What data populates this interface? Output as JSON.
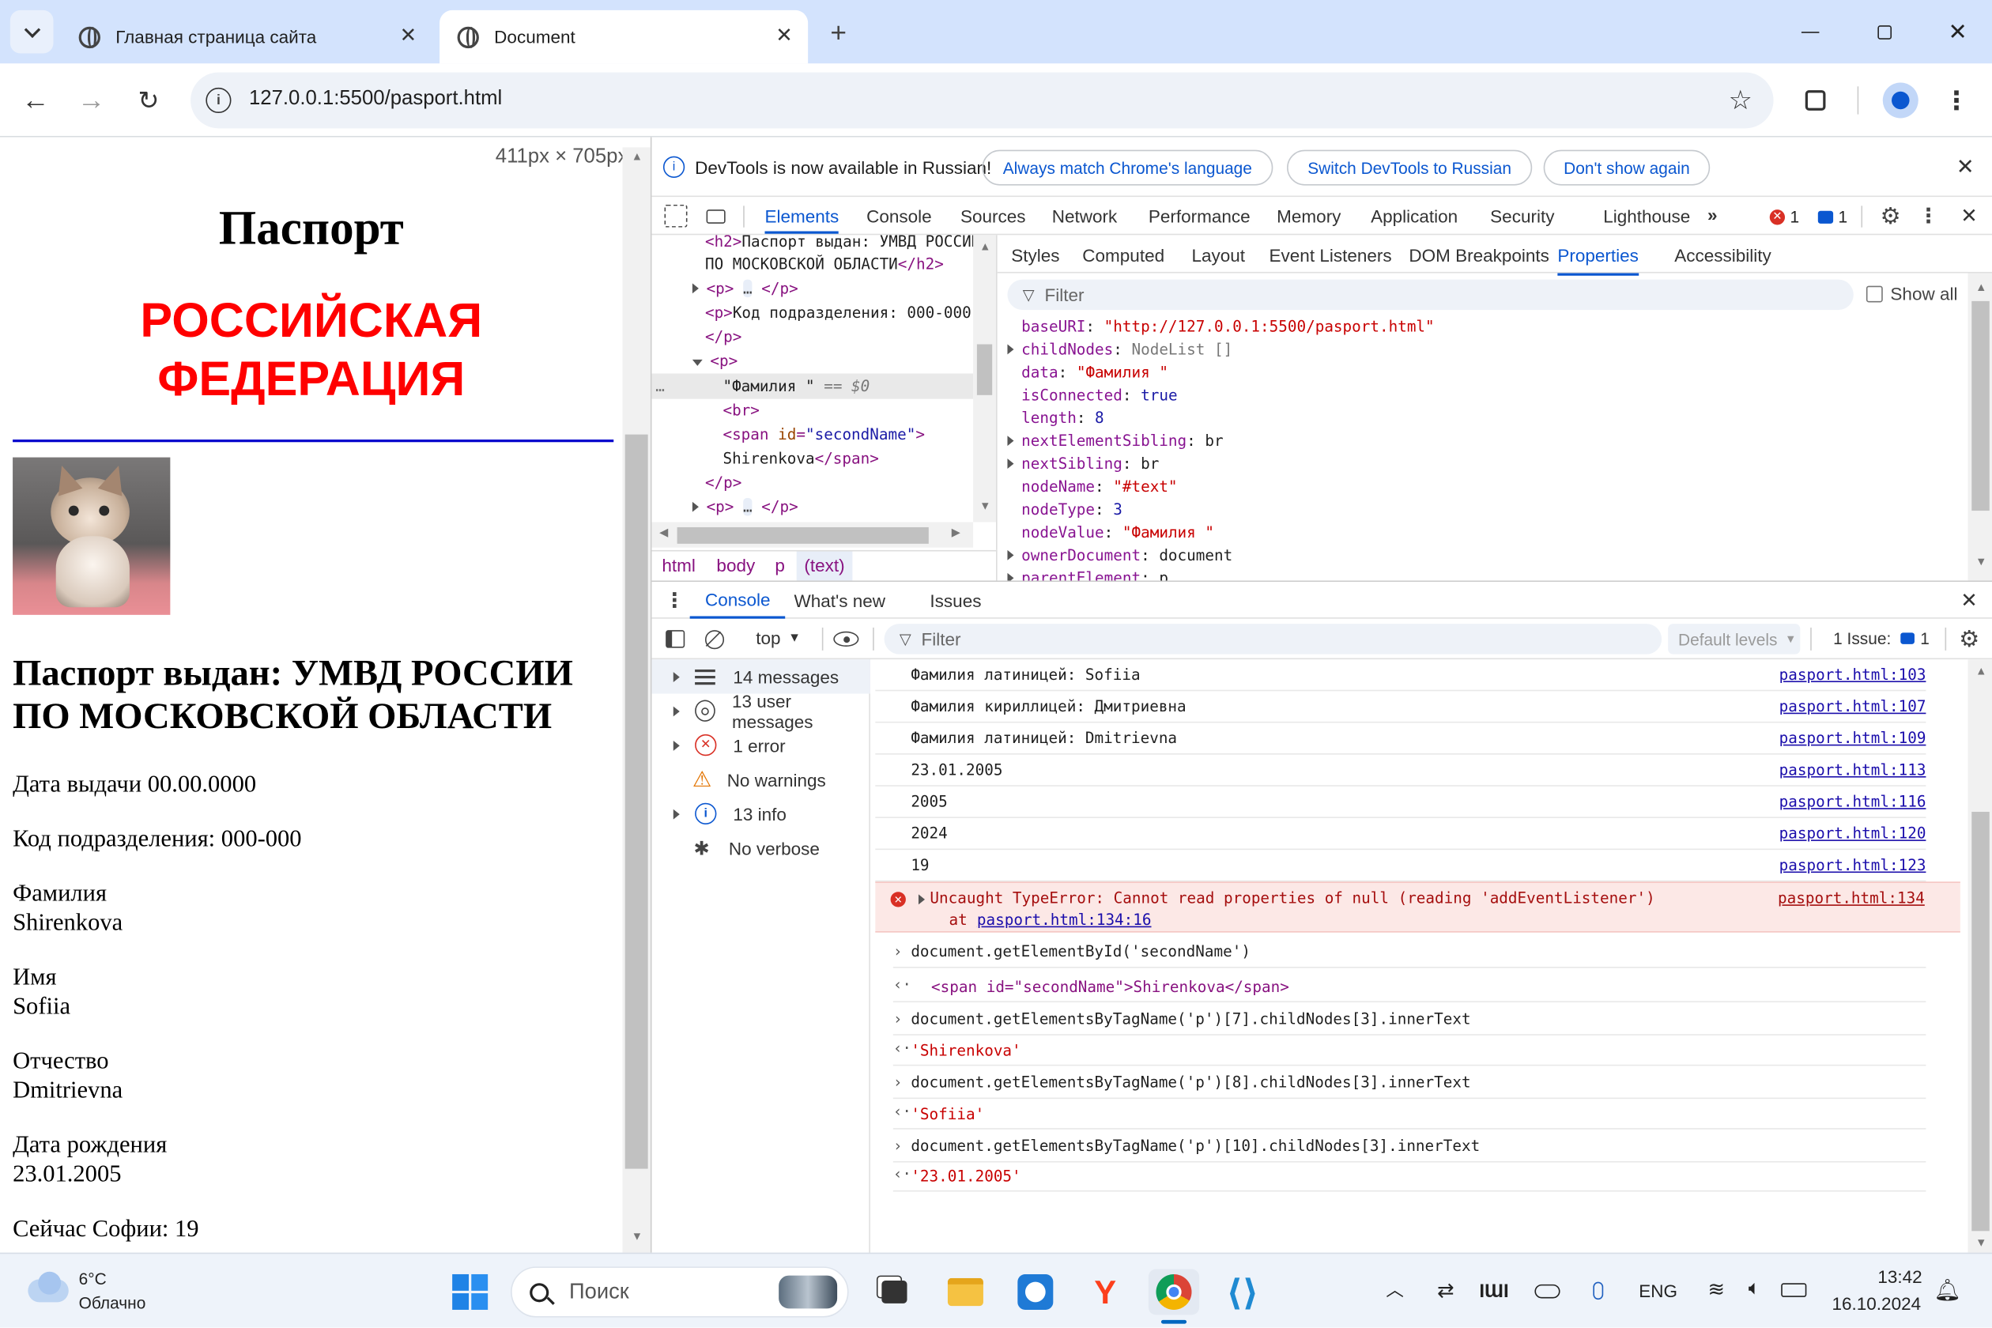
{
  "browser": {
    "tabs": [
      {
        "title": "Главная страница сайта"
      },
      {
        "title": "Document"
      }
    ],
    "url": "127.0.0.1:5500/pasport.html",
    "viewport_size": "411px × 705px"
  },
  "page": {
    "title": "Паспорт",
    "country_line1": "РОССИЙСКАЯ",
    "country_line2": "ФЕДЕРАЦИЯ",
    "issued_line1": "Паспорт выдан: УМВД РОССИИ",
    "issued_line2": "ПО МОСКОВСКОЙ ОБЛАСТИ",
    "issue_date": "Дата выдачи 00.00.0000",
    "division_code": "Код подразделения: 000-000",
    "surname_label": "Фамилия",
    "surname": "Shirenkova",
    "name_label": "Имя",
    "name": "Sofiia",
    "patronymic_label": "Отчество",
    "patronymic": "Dmitrievna",
    "birth_label": "Дата рождения",
    "birth": "23.01.2005",
    "age_line": "Сейчас Софии: 19"
  },
  "devtools": {
    "infobar": {
      "text": "DevTools is now available in Russian!",
      "btn1": "Always match Chrome's language",
      "btn2": "Switch DevTools to Russian",
      "btn3": "Don't show again"
    },
    "main_tabs": [
      "Elements",
      "Console",
      "Sources",
      "Network",
      "Performance",
      "Memory",
      "Application",
      "Security",
      "Lighthouse"
    ],
    "errors_count": "1",
    "issues_count": "1",
    "elements": {
      "l1": "ПО МОСКОВСКОЙ ОБЛАСТИ",
      "l2_text": "Код подразделения: 000-000",
      "l5_text": "\"Фамилия \"",
      "l5_eq": "== $0",
      "l7_attr_val": "\"secondName\"",
      "l8_text": "Shirenkova",
      "l0_text": "Паспорт выдан: УМВД РОССИИ"
    },
    "breadcrumbs": [
      "html",
      "body",
      "p",
      "(text)"
    ],
    "side_tabs": [
      "Styles",
      "Computed",
      "Layout",
      "Event Listeners",
      "DOM Breakpoints",
      "Properties",
      "Accessibility"
    ],
    "filter_placeholder": "Filter",
    "show_all": "Show all",
    "properties": [
      {
        "k": "baseURI",
        "v": "\"http://127.0.0.1:5500/pasport.html\"",
        "t": "str",
        "exp": false
      },
      {
        "k": "childNodes",
        "v": "NodeList []",
        "t": "obj",
        "exp": true
      },
      {
        "k": "data",
        "v": "\"Фамилия \"",
        "t": "str",
        "exp": false
      },
      {
        "k": "isConnected",
        "v": "true",
        "t": "num",
        "exp": false
      },
      {
        "k": "length",
        "v": "8",
        "t": "num",
        "exp": false
      },
      {
        "k": "nextElementSibling",
        "v": "br",
        "t": "plain",
        "exp": true
      },
      {
        "k": "nextSibling",
        "v": "br",
        "t": "plain",
        "exp": true
      },
      {
        "k": "nodeName",
        "v": "\"#text\"",
        "t": "str",
        "exp": false
      },
      {
        "k": "nodeType",
        "v": "3",
        "t": "num",
        "exp": false
      },
      {
        "k": "nodeValue",
        "v": "\"Фамилия \"",
        "t": "str",
        "exp": false
      },
      {
        "k": "ownerDocument",
        "v": "document",
        "t": "plain",
        "exp": true
      },
      {
        "k": "parentElement",
        "v": "p",
        "t": "plain",
        "exp": true
      }
    ],
    "drawer_tabs": [
      "Console",
      "What's new",
      "Issues"
    ],
    "console_toolbar": {
      "context": "top",
      "filter": "Filter",
      "levels": "Default levels",
      "issues": "1 Issue:",
      "issue_count": "1"
    },
    "sidebar": [
      {
        "label": "14 messages",
        "icon": "list-icon"
      },
      {
        "label": "13 user messages",
        "icon": "user-icon"
      },
      {
        "label": "1 error",
        "icon": "error-icon"
      },
      {
        "label": "No warnings",
        "icon": "warning-icon"
      },
      {
        "label": "13 info",
        "icon": "info-icon"
      },
      {
        "label": "No verbose",
        "icon": "bug-icon"
      }
    ],
    "logs": [
      {
        "text": "Фамилия латиницей: Sofiia",
        "src": "pasport.html:103"
      },
      {
        "text": "Фамилия кириллицей: Дмитриевна",
        "src": "pasport.html:107"
      },
      {
        "text": "Фамилия латиницей: Dmitrievna",
        "src": "pasport.html:109"
      },
      {
        "text": "23.01.2005",
        "src": "pasport.html:113"
      },
      {
        "text": "2005",
        "src": "pasport.html:116"
      },
      {
        "text": "2024",
        "src": "pasport.html:120"
      },
      {
        "text": "19",
        "src": "pasport.html:123"
      }
    ],
    "error": {
      "msg": "Uncaught TypeError: Cannot read properties of null (reading 'addEventListener')",
      "at": "at",
      "at_link": "pasport.html:134:16",
      "src": "pasport.html:134"
    },
    "cmds": [
      {
        "in": "document.getElementById('secondName')",
        "out": "<span id=\"secondName\">Shirenkova</span>"
      },
      {
        "in": "document.getElementsByTagName('p')[7].childNodes[3].innerText",
        "out": "'Shirenkova'"
      },
      {
        "in": "document.getElementsByTagName('p')[8].childNodes[3].innerText",
        "out": "'Sofiia'"
      },
      {
        "in": "document.getElementsByTagName('p')[10].childNodes[3].innerText",
        "out": "'23.01.2005'"
      }
    ]
  },
  "taskbar": {
    "temp": "6°C",
    "weather": "Облачно",
    "search": "Поиск",
    "lang": "ENG",
    "time": "13:42",
    "date": "16.10.2024"
  }
}
